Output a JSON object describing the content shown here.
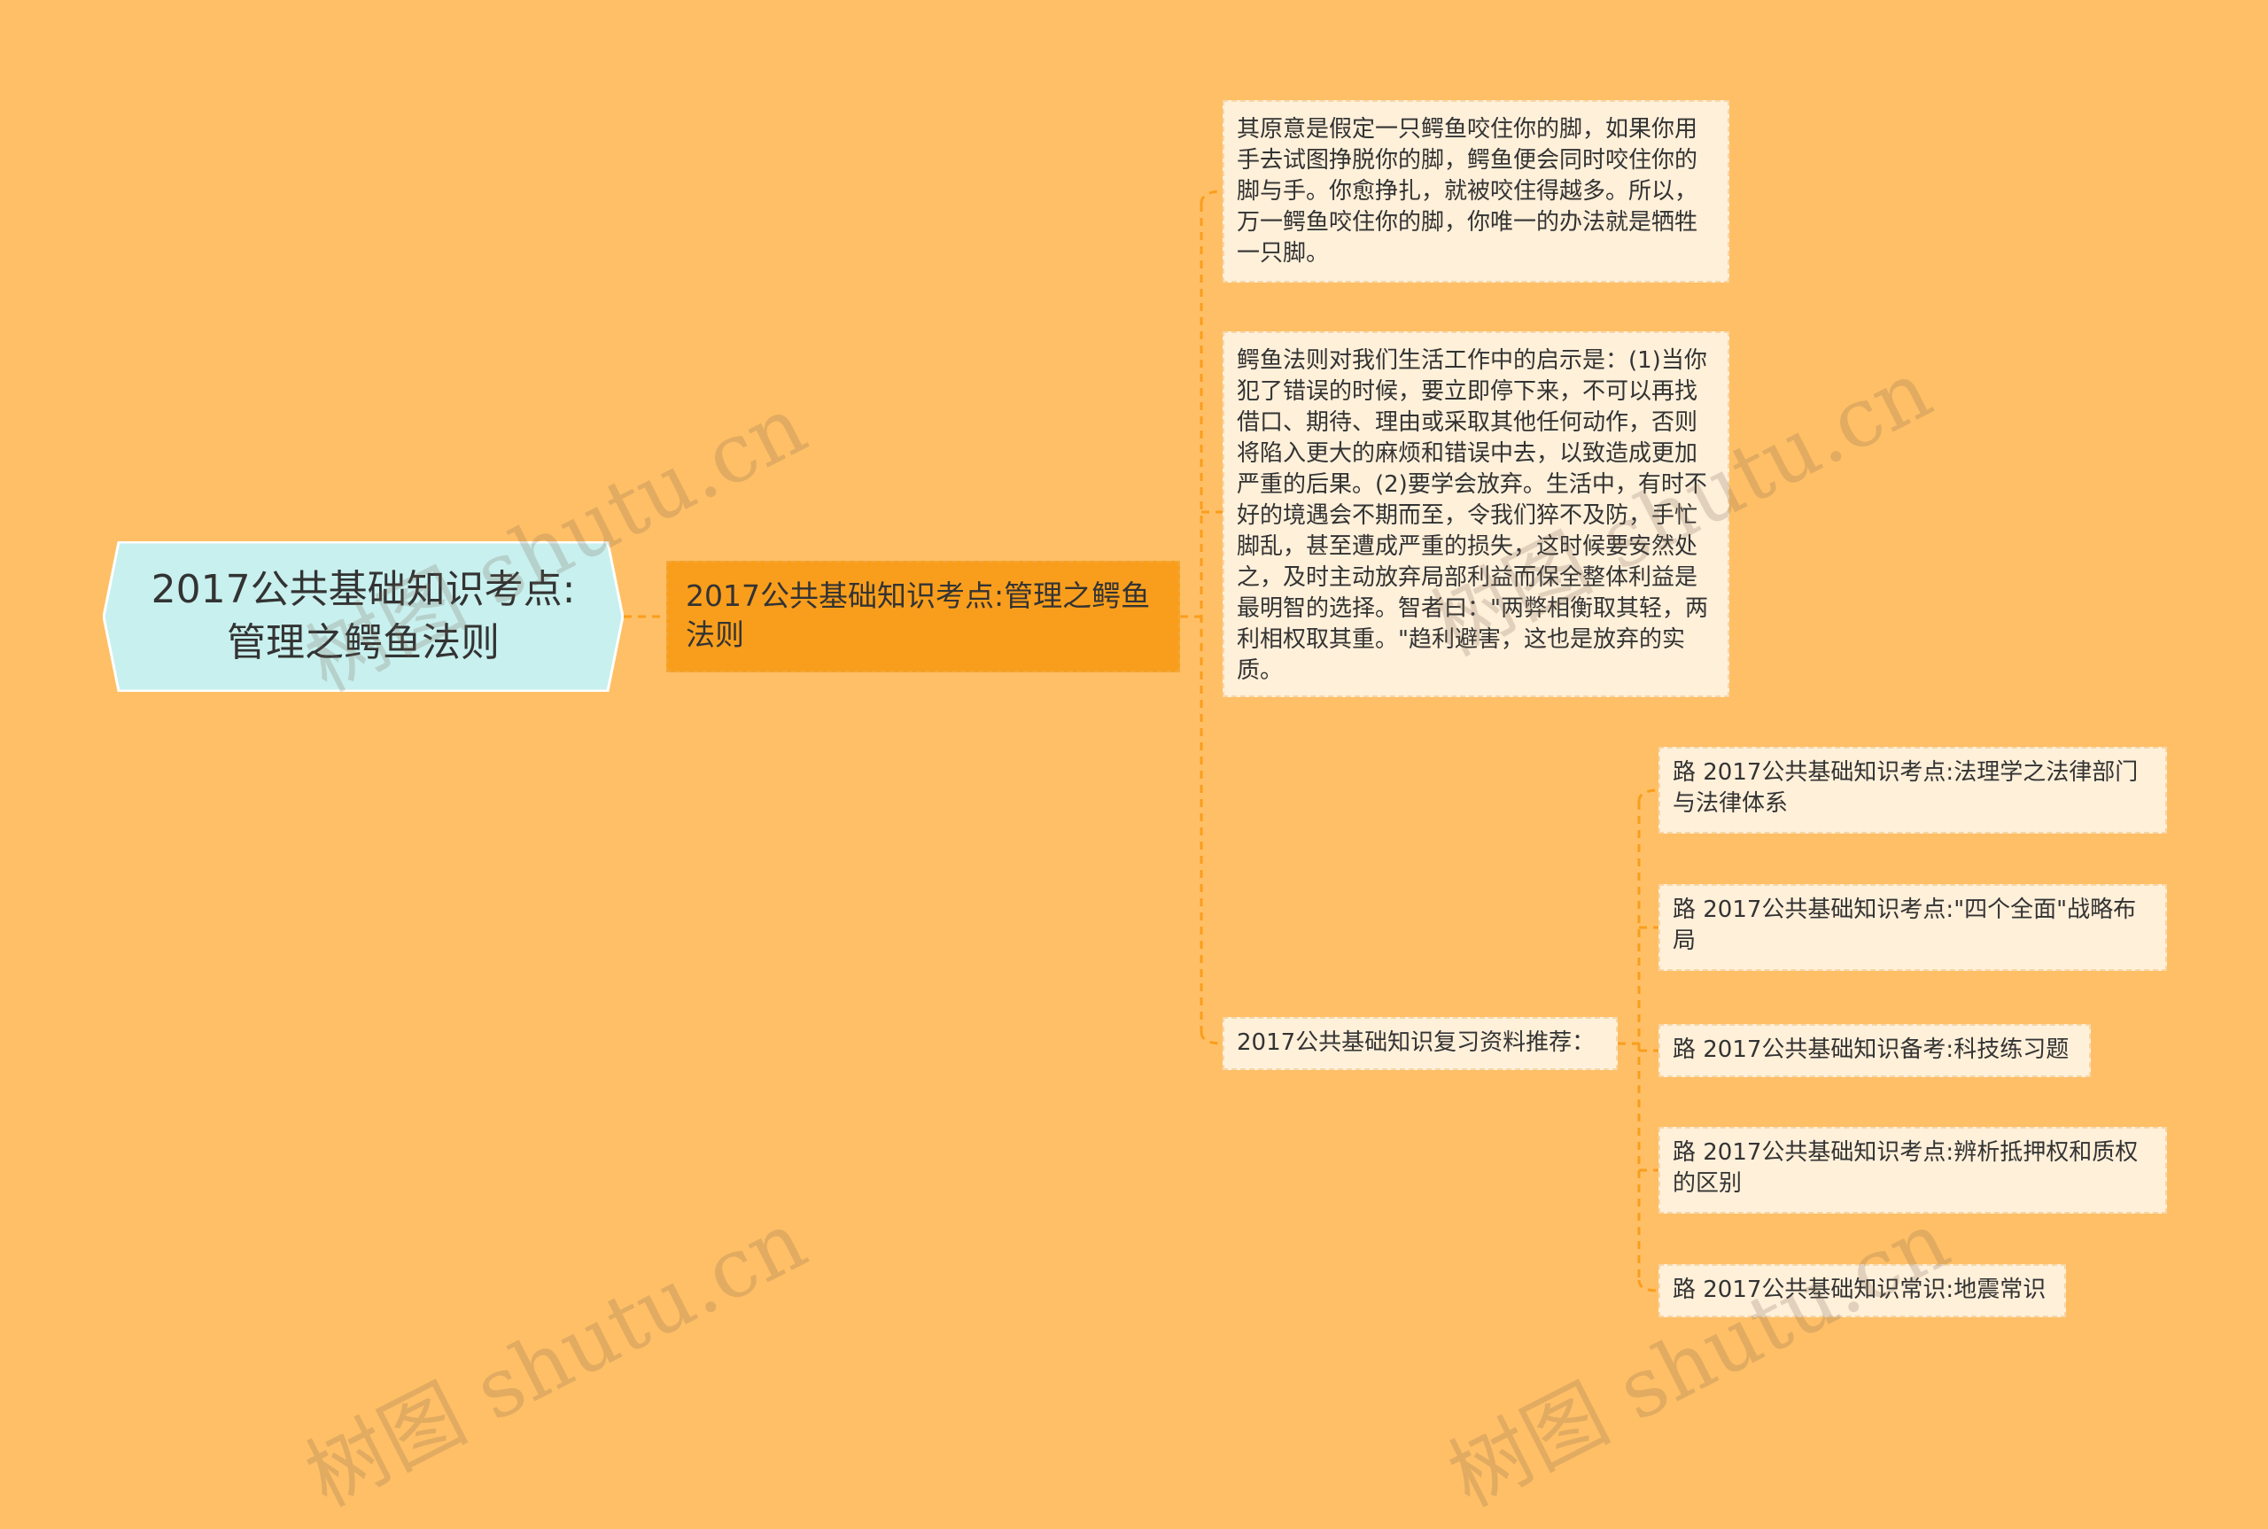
{
  "colors": {
    "background": "#ffbf66",
    "root_fill": "#c8f0ee",
    "main_fill": "#f99e1c",
    "leaf_fill": "#fff0da",
    "connector": "#f99e1c"
  },
  "root": {
    "title": "2017公共基础知识考点:管理之鳄鱼法则"
  },
  "main": {
    "title": "2017公共基础知识考点:管理之鳄鱼法则"
  },
  "leaves": [
    {
      "text": "其原意是假定一只鳄鱼咬住你的脚，如果你用手去试图挣脱你的脚，鳄鱼便会同时咬住你的脚与手。你愈挣扎，就被咬住得越多。所以，万一鳄鱼咬住你的脚，你唯一的办法就是牺牲一只脚。"
    },
    {
      "text": "鳄鱼法则对我们生活工作中的启示是：(1)当你犯了错误的时候，要立即停下来，不可以再找借口、期待、理由或采取其他任何动作，否则将陷入更大的麻烦和错误中去，以致造成更加严重的后果。(2)要学会放弃。生活中，有时不好的境遇会不期而至，令我们猝不及防，手忙脚乱，甚至遭成严重的损失，这时候要安然处之，及时主动放弃局部利益而保全整体利益是最明智的选择。智者曰：\"两弊相衡取其轻，两利相权取其重。\"趋利避害，这也是放弃的实质。"
    },
    {
      "text": "2017公共基础知识复习资料推荐："
    }
  ],
  "recommendations": [
    {
      "text": "路 2017公共基础知识考点:法理学之法律部门与法律体系"
    },
    {
      "text": "路 2017公共基础知识考点:\"四个全面\"战略布局"
    },
    {
      "text": "路 2017公共基础知识备考:科技练习题"
    },
    {
      "text": "路 2017公共基础知识考点:辨析抵押权和质权的区别"
    },
    {
      "text": "路 2017公共基础知识常识:地震常识"
    }
  ],
  "watermark": "树图 shutu.cn"
}
